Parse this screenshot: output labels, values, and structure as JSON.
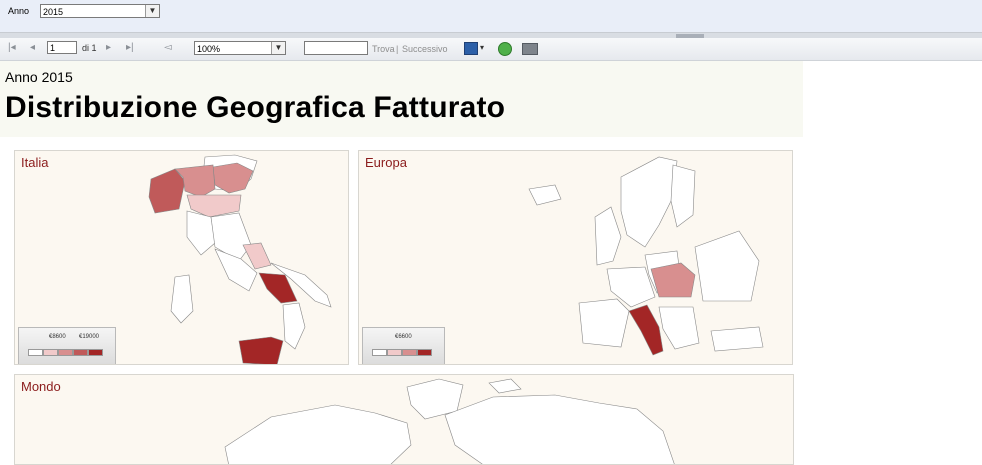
{
  "param_bar": {
    "label": "Anno",
    "selected_value": "2015"
  },
  "toolbar": {
    "page_value": "1",
    "page_of": "di 1",
    "zoom": "100%",
    "find_label": "Trova",
    "find_separator": "|",
    "next_label": "Successivo"
  },
  "report": {
    "subtitle": "Anno 2015",
    "title": "Distribuzione Geografica Fatturato"
  },
  "panels": {
    "italia": {
      "title": "Italia",
      "legend_low": "€8600",
      "legend_high": "€19000"
    },
    "europa": {
      "title": "Europa",
      "legend_low": "€6600"
    },
    "mondo": {
      "title": "Mondo"
    }
  },
  "colors": {
    "scale": [
      "#ffffff",
      "#f1caca",
      "#d88f8f",
      "#c05a5a",
      "#a32626"
    ],
    "accent_title": "#8b1c1c"
  }
}
